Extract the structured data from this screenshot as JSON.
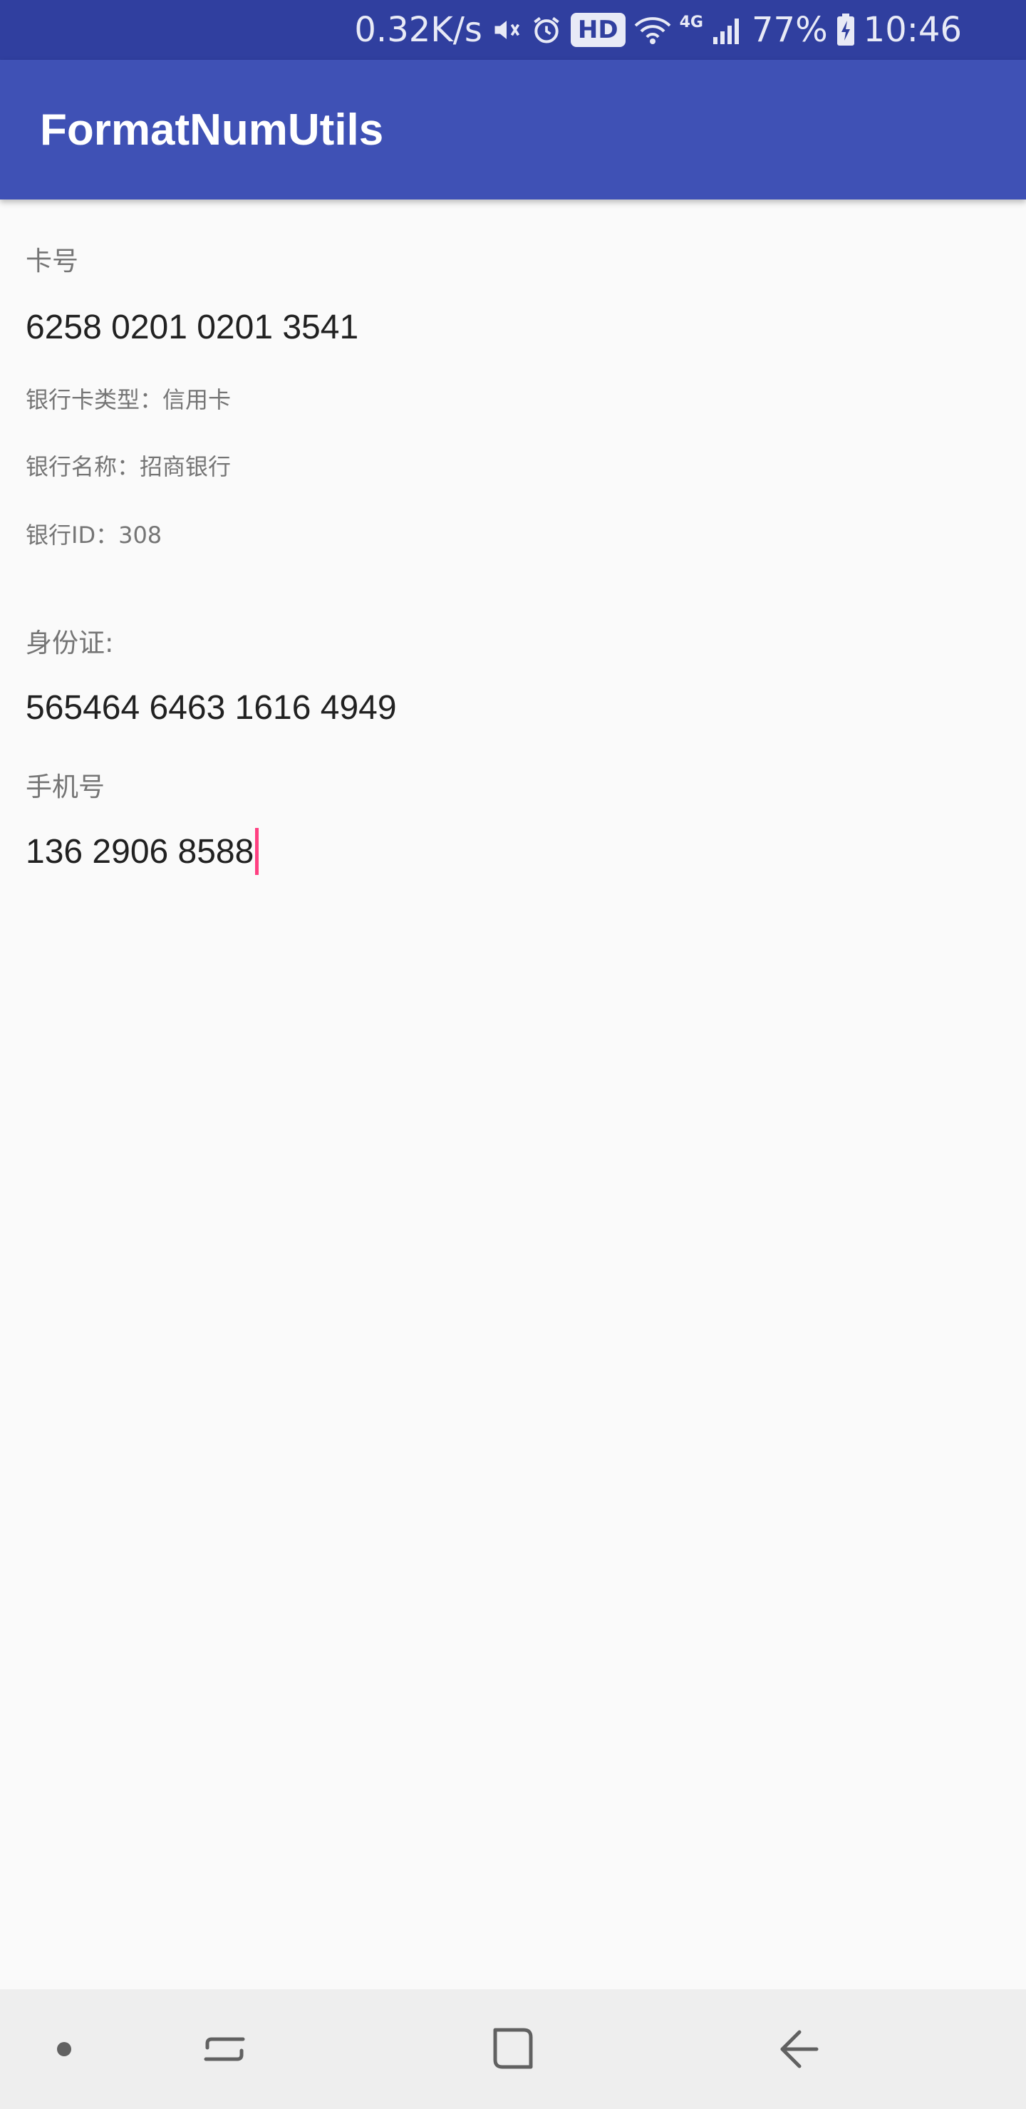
{
  "status_bar": {
    "net_speed": "0.32K/s",
    "hd_badge": "HD",
    "network_type": "4G",
    "battery": "77%",
    "time": "10:46"
  },
  "toolbar": {
    "title": "FormatNumUtils"
  },
  "card": {
    "label": "卡号",
    "number": "6258 0201 0201 3541",
    "type_text": "银行卡类型：信用卡",
    "bank_name_text": "银行名称：招商银行",
    "bank_id_text": "银行ID：308"
  },
  "id_card": {
    "label": "身份证:",
    "number": "565464 6463 1616 4949"
  },
  "phone": {
    "label": "手机号",
    "number": "136 2906 8588"
  },
  "colors": {
    "status_bar": "#303f9f",
    "toolbar": "#3f51b5",
    "accent": "#ff4081",
    "background": "#fafafa",
    "nav_bar": "#eeeeee"
  },
  "icons": {
    "status": [
      "mute-icon",
      "alarm-icon",
      "wifi-icon",
      "signal-icon",
      "battery-charging-icon"
    ],
    "navigation": [
      "dot-icon",
      "recent-apps-icon",
      "home-icon",
      "back-icon"
    ]
  }
}
